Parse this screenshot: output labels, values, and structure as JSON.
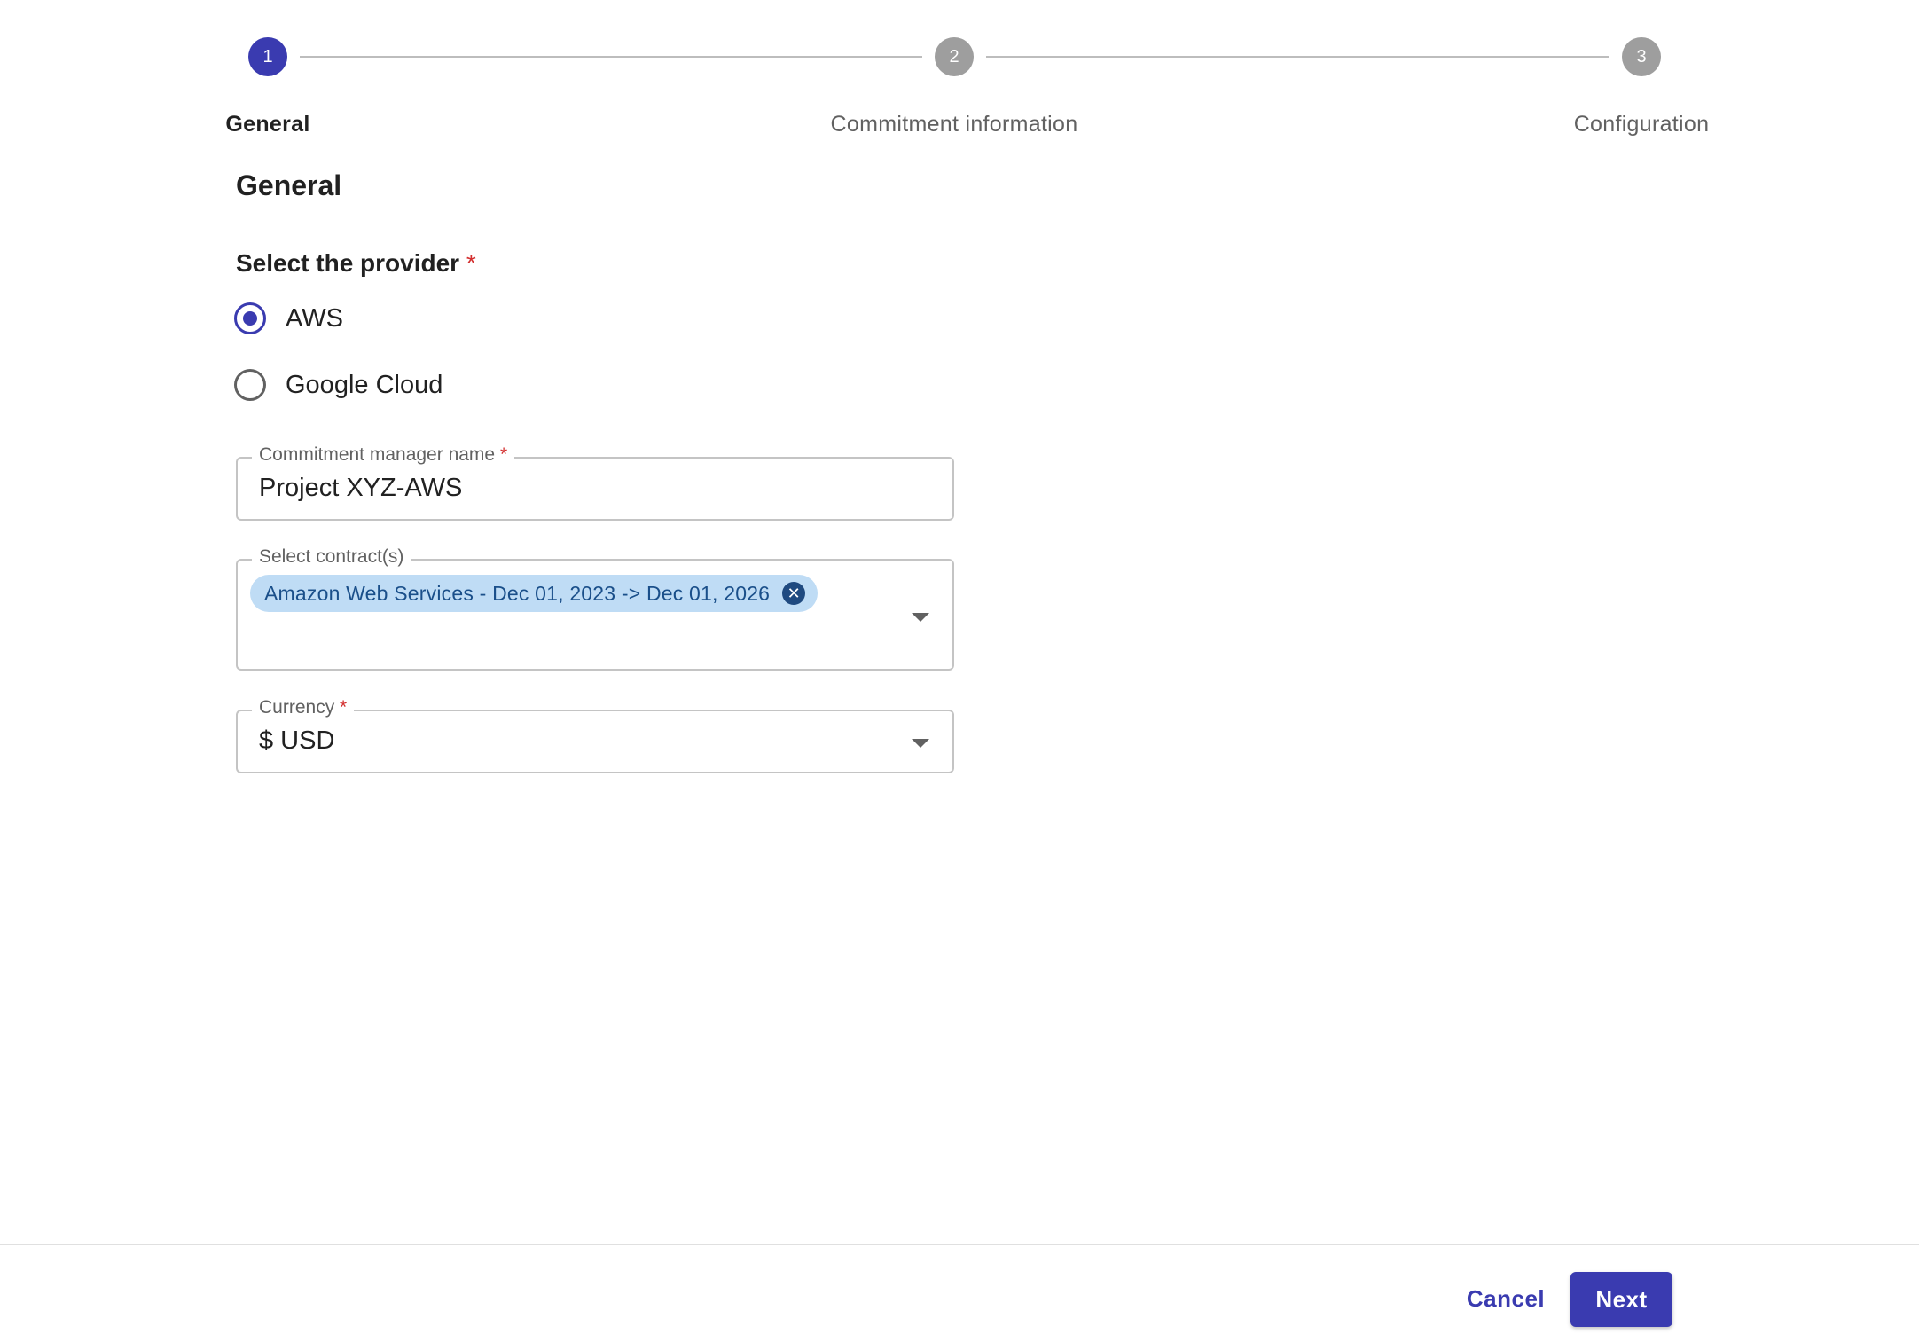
{
  "stepper": {
    "steps": [
      {
        "number": "1",
        "label": "General",
        "active": true
      },
      {
        "number": "2",
        "label": "Commitment information",
        "active": false
      },
      {
        "number": "3",
        "label": "Configuration",
        "active": false
      }
    ]
  },
  "form": {
    "section_title": "General",
    "provider": {
      "label": "Select the provider",
      "required_mark": "*",
      "options": [
        {
          "label": "AWS",
          "selected": true
        },
        {
          "label": "Google Cloud",
          "selected": false
        }
      ]
    },
    "manager_name": {
      "label": "Commitment manager name",
      "required_mark": "*",
      "value": "Project XYZ-AWS"
    },
    "contracts": {
      "label": "Select contract(s)",
      "chips": [
        "Amazon Web Services - Dec 01, 2023 -> Dec 01, 2026"
      ],
      "chip_close_glyph": "✕",
      "icon": "chevron-down-icon"
    },
    "currency": {
      "label": "Currency",
      "required_mark": "*",
      "value": "$ USD",
      "icon": "chevron-down-icon"
    }
  },
  "footer": {
    "cancel_label": "Cancel",
    "next_label": "Next"
  },
  "colors": {
    "primary": "#3a3bb0",
    "inactive_step": "#9e9e9e",
    "required": "#d32f2f",
    "chip_bg": "#bfdcf5",
    "chip_text": "#1a4f8a"
  }
}
